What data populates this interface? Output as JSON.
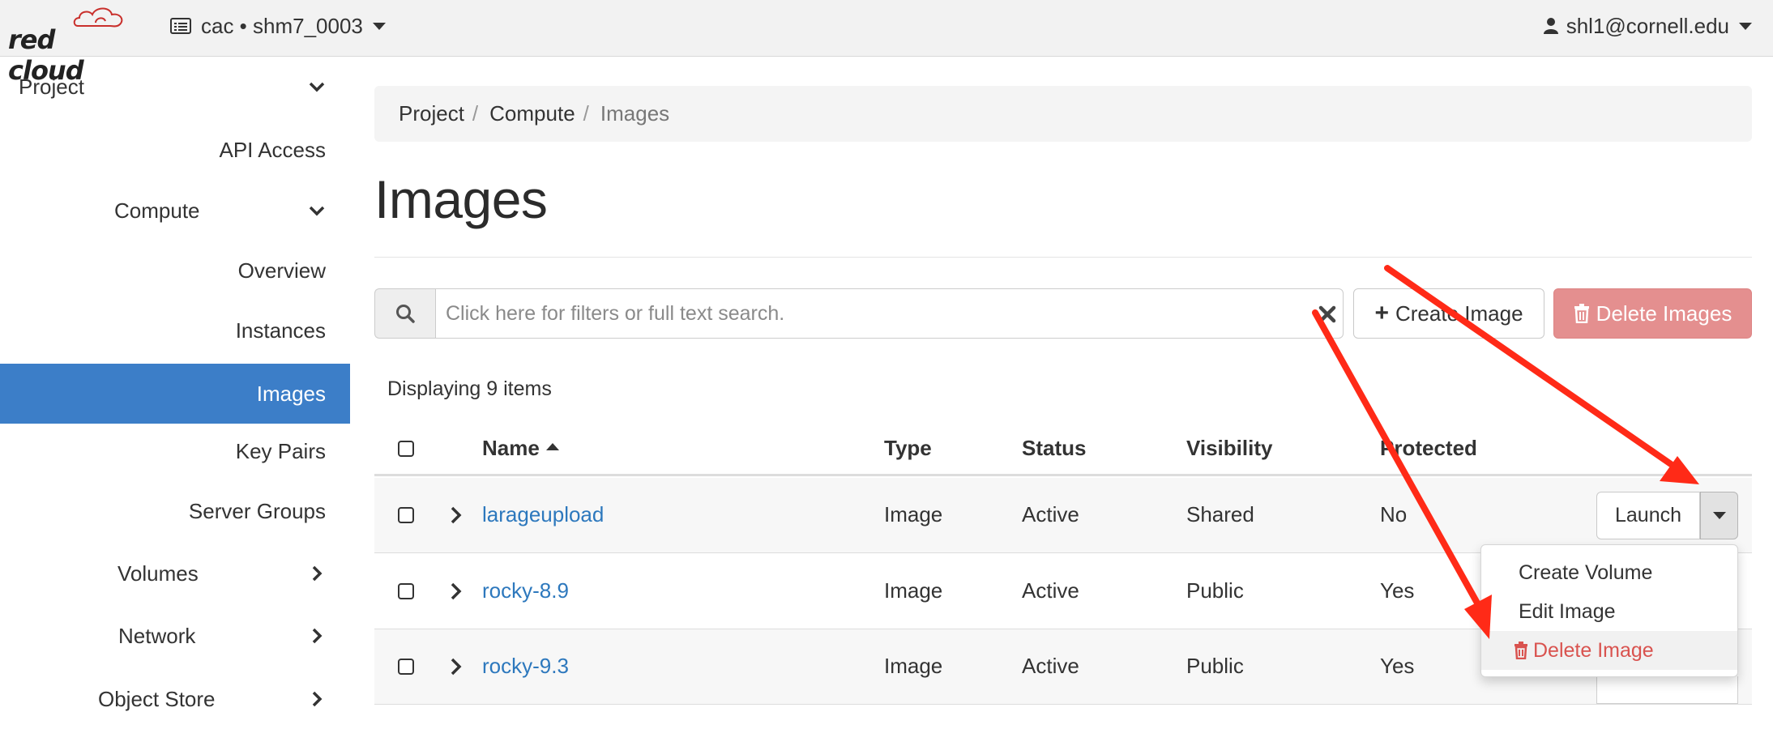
{
  "brand": {
    "logo_text": "red cloud"
  },
  "header": {
    "project_switcher": "cac • shm7_0003",
    "user": "shl1@cornell.edu"
  },
  "sidebar": {
    "project": "Project",
    "api_access": "API Access",
    "compute": "Compute",
    "overview": "Overview",
    "instances": "Instances",
    "images": "Images",
    "key_pairs": "Key Pairs",
    "server_groups": "Server Groups",
    "volumes": "Volumes",
    "network": "Network",
    "object_store": "Object Store"
  },
  "breadcrumb": {
    "project": "Project",
    "compute": "Compute",
    "current": "Images",
    "separator": "/"
  },
  "page": {
    "title": "Images"
  },
  "toolbar": {
    "search_placeholder": "Click here for filters or full text search.",
    "create_label": "Create Image",
    "delete_label": "Delete Images"
  },
  "table": {
    "count_text": "Displaying 9 items",
    "columns": {
      "name": "Name",
      "type": "Type",
      "status": "Status",
      "visibility": "Visibility",
      "protected": "Protected"
    },
    "rows": [
      {
        "name": "larageupload",
        "type": "Image",
        "status": "Active",
        "visibility": "Shared",
        "protected": "No"
      },
      {
        "name": "rocky-8.9",
        "type": "Image",
        "status": "Active",
        "visibility": "Public",
        "protected": "Yes"
      },
      {
        "name": "rocky-9.3",
        "type": "Image",
        "status": "Active",
        "visibility": "Public",
        "protected": "Yes"
      }
    ],
    "row_action": "Launch"
  },
  "row_menu": {
    "create_volume": "Create Volume",
    "edit_image": "Edit Image",
    "delete_image": "Delete Image"
  },
  "colors": {
    "active_nav": "#3c7ec8",
    "link": "#2d78bd",
    "danger": "#d9534f",
    "danger_button": "#e48f8f",
    "annotation_arrow": "#ff2a17"
  }
}
